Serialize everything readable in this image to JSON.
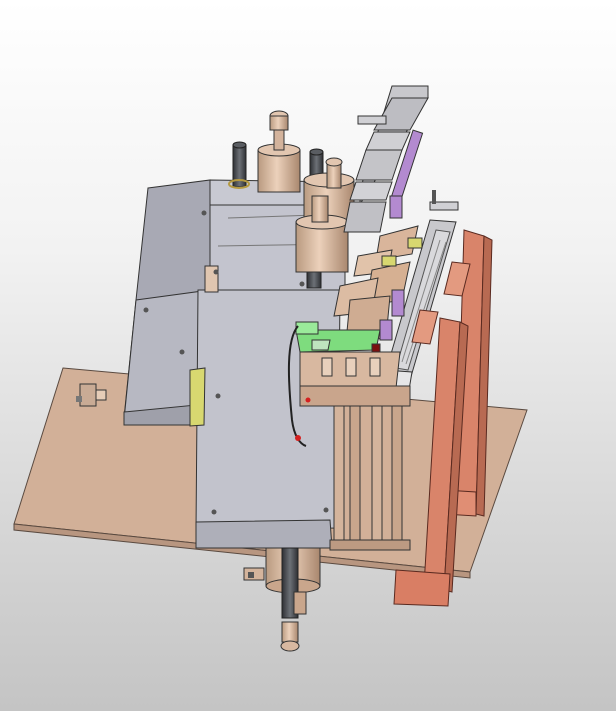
{
  "viewport": {
    "background_top": "#ffffff",
    "background_bottom": "#c4c4c4"
  },
  "model": {
    "colors": {
      "base_plate": "#d4b29a",
      "frame_gray": "#b9bac4",
      "frame_gray_dark": "#9a9ba6",
      "copper_part": "#d9b59b",
      "bracket_red": "#d9846a",
      "rail_silver": "#c8c8cc",
      "slide_purple": "#b38ad0",
      "clamp_green": "#7edc7e",
      "accent_yellow": "#d8d870",
      "rod_dark": "#4a4d52"
    }
  }
}
